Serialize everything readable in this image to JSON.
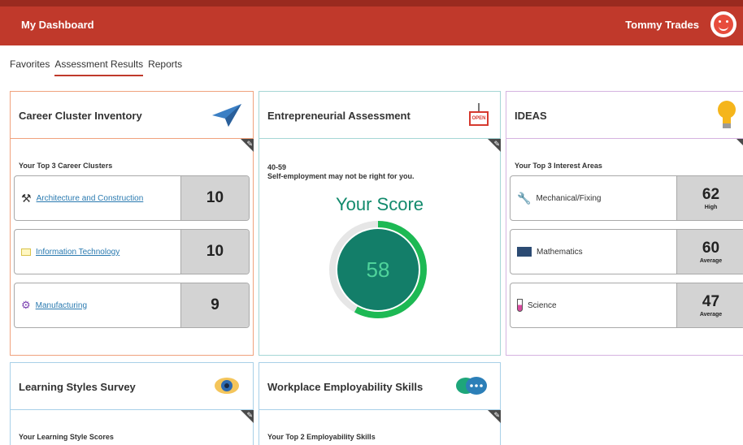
{
  "header": {
    "title": "My Dashboard",
    "user_name": "Tommy Trades",
    "avatar_icon": "smiley-avatar-icon"
  },
  "tabs": [
    {
      "label": "Favorites",
      "active": false
    },
    {
      "label": "Assessment Results",
      "active": true
    },
    {
      "label": "Reports",
      "active": false
    }
  ],
  "cards": {
    "career": {
      "title": "Career Cluster Inventory",
      "icon": "paper-plane-icon",
      "subtitle": "Your Top 3 Career Clusters",
      "rows": [
        {
          "icon": "tools-icon",
          "label": "Architecture and Construction",
          "score": "10"
        },
        {
          "icon": "computer-icon",
          "label": "Information Technology",
          "score": "10"
        },
        {
          "icon": "gears-icon",
          "label": "Manufacturing",
          "score": "9"
        }
      ]
    },
    "entrepreneurial": {
      "title": "Entrepreneurial Assessment",
      "icon": "open-sign-icon",
      "icon_text": "OPEN",
      "range": "40-59",
      "message": "Self-employment may not be right for you.",
      "score_label": "Your Score",
      "score": "58",
      "score_fraction": 0.58
    },
    "ideas": {
      "title": "IDEAS",
      "icon": "light-bulb-icon",
      "subtitle": "Your Top 3 Interest Areas",
      "rows": [
        {
          "icon": "wrench-screwdriver-icon",
          "label": "Mechanical/Fixing",
          "score": "62",
          "level": "High"
        },
        {
          "icon": "chalkboard-icon",
          "label": "Mathematics",
          "score": "60",
          "level": "Average"
        },
        {
          "icon": "test-tube-icon",
          "label": "Science",
          "score": "47",
          "level": "Average"
        }
      ]
    },
    "learning": {
      "title": "Learning Styles Survey",
      "icon": "eye-icon",
      "subtitle": "Your Learning Style Scores"
    },
    "workplace": {
      "title": "Workplace Employability Skills",
      "icon": "chat-bubbles-icon",
      "subtitle": "Your Top 2 Employability Skills"
    }
  },
  "colors": {
    "header_red": "#c0392b",
    "gauge_green": "#1db954",
    "gauge_dark": "#137e69",
    "link_blue": "#2a7ab0"
  }
}
